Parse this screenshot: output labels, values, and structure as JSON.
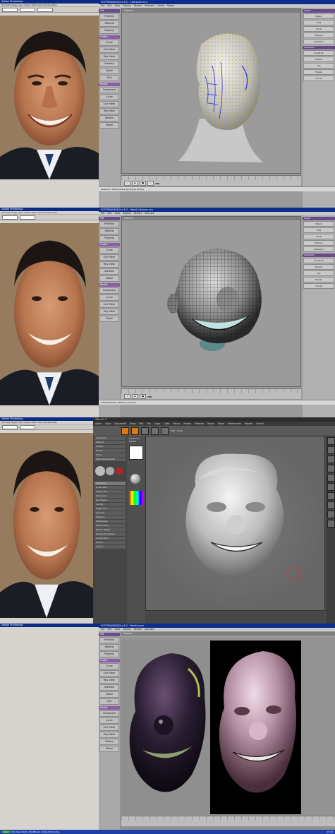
{
  "photoshop": {
    "title": "Adobe Photoshop",
    "menu": "File  Edit  Image  Layer  Select  Filter  View  Window  Help"
  },
  "panel1": {
    "xsi_title": "SOFTIMAGE|XSI v.3.0 - Character.scn",
    "menu": [
      "File",
      "Edit",
      "View",
      "Display",
      "Render",
      "Animate",
      "Create",
      "Model",
      "Property",
      "Transform",
      "Window",
      "Help"
    ],
    "viewport_label": "Camera",
    "sidebar": [
      "Get",
      "Primitive",
      "Material",
      "Property",
      "Create",
      "Curve",
      "Surf. Mesh",
      "Poly. Mesh",
      "Skeleton",
      "Model",
      "Text",
      "Modify",
      "Component",
      "Curve",
      "Surf. Mesh",
      "Poly. Mesh",
      "Deform",
      "Model"
    ],
    "right": [
      "Select",
      "Object",
      "Edit",
      "Point",
      "Explore",
      "Selection",
      "Transform",
      "Constrain",
      "Parent",
      "Cut",
      "Freeze",
      "Group"
    ],
    "status": "Selection: Head_Character.Poly(0 Points)",
    "frame": "100"
  },
  "panel2": {
    "xsi_title": "SOFTIMAGE|XSI v.3.0 - Head_Cartoon.scn",
    "viewport_label": "Camera",
    "status": "AddToSelection Selection_Current",
    "frame": "100"
  },
  "panel3": {
    "title": "ZBrush 2",
    "menu": [
      "Alpha",
      "Color",
      "Document",
      "Draw",
      "Edit",
      "File",
      "Layer",
      "Light",
      "Macro",
      "Marker",
      "Material",
      "Movie",
      "Picker",
      "Preferences",
      "Render",
      "Stencil",
      "Stroke",
      "Texture",
      "Tool",
      "Transform",
      "Zplugin",
      "Zscript"
    ],
    "tool_labels": [
      "Move",
      "Scale",
      "Rotate",
      "Edit",
      "Draw"
    ],
    "sidebar": [
      "Load Tool",
      "Save As",
      "Import",
      "Export",
      "Clone",
      "Make PolyMesh3D",
      "Geometry",
      "Lower Res",
      "Higher Res",
      "Del Lower",
      "Del Higher",
      "Subdiv",
      "Edge Loop",
      "Smooth",
      "Masking",
      "Polygroups",
      "Deformation",
      "Morph Target",
      "Display Properties",
      "Unified Skin",
      "Export",
      "Import"
    ],
    "palette_title": "Projection Master"
  },
  "panel4": {
    "xsi_title": "SOFTIMAGE|XSI v.3.0 - Render.scn",
    "menu": [
      "File",
      "Edit",
      "View",
      "Display",
      "Render",
      "Animate",
      "Create",
      "Model",
      "Property",
      "Transform",
      "Window",
      "Help"
    ],
    "viewport_label": "Camera",
    "sidebar": [
      "Get",
      "Primitive",
      "Material",
      "Property",
      "Create",
      "Curve",
      "Surf. Mesh",
      "Poly. Mesh",
      "Skeleton",
      "Model",
      "Text",
      "Modify",
      "Component",
      "Curve",
      "Surf. Mesh",
      "Poly. Mesh",
      "Deform",
      "Model"
    ],
    "taskbar": [
      "Start",
      "Windows Media",
      "XSI",
      "ZBrush",
      "Adobe Photoshop"
    ],
    "clock": "10:34"
  },
  "colors": {
    "xsi_title": "#0d2e8c",
    "xsi_panel_header": "#6a4a8a",
    "zbrush_accent": "#e07a10",
    "taskbar": "#1e3fa8"
  }
}
